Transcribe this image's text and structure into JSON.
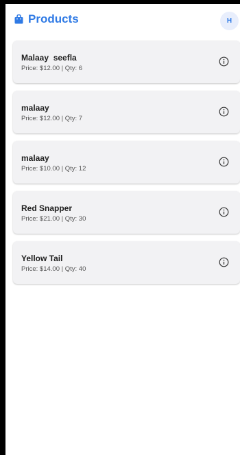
{
  "header": {
    "title": "Products",
    "avatar_initial": "H",
    "accent_color": "#2f7ae5",
    "icon": "shopping-bag-icon"
  },
  "products": [
    {
      "name": "Malaay  seefla",
      "details": "Price: $12.00 | Qty: 6"
    },
    {
      "name": "malaay",
      "details": "Price: $12.00 | Qty: 7"
    },
    {
      "name": "malaay",
      "details": "Price: $10.00 | Qty: 12"
    },
    {
      "name": "Red Snapper",
      "details": "Price: $21.00 | Qty: 30"
    },
    {
      "name": "Yellow Tail",
      "details": "Price: $14.00 | Qty: 40"
    }
  ],
  "item_icon": "info-icon"
}
